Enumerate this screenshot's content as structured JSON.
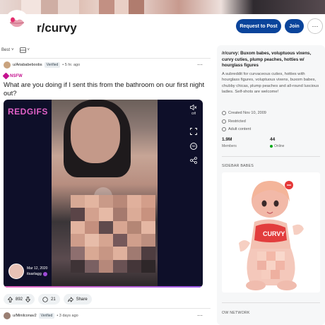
{
  "subreddit": {
    "name": "r/curvy",
    "request_button": "Request to Post",
    "join_button": "Join",
    "more_button": "⋯"
  },
  "sort": {
    "selected": "Best",
    "chevron": "˅",
    "view_chevron": "˅"
  },
  "post": {
    "author": "u/Ariababeboobs",
    "author_badge": "Verified",
    "time": "• 5 hr. ago",
    "menu": "⋯",
    "nsfw_label": "NSFW",
    "title": "What are you doing if I sent this from the bathroom on our first night out?",
    "media": {
      "brand": "REDGIFS",
      "mute_label": "Off",
      "sd_label": "SD",
      "creator_date": "Mar 12, 2020",
      "creator_handle": "itsarlagg",
      "progress_percent": 100
    },
    "upvotes": "892",
    "comments": "21",
    "share": "Share"
  },
  "next_post": {
    "author": "u/Minilconav2",
    "author_badge": "Verified",
    "time": "• 3 days ago",
    "menu": "⋯"
  },
  "sidebar": {
    "title": "/r/curvy: Buxom babes, voluptuous vixens, curvy cuties, plump peaches, hotties w/ hourglass figures",
    "description": "A subreddit for curvaceous cuties, hotties with hourglass figures, voluptuous vixens, buxom babes, chubby chicas, plump peaches and all-round luscious ladies. Self-shots are welcome!",
    "created": "Created Nov 10, 2009",
    "restricted": "Restricted",
    "adult": "Adult content",
    "members_value": "1.9M",
    "members_label": "Members",
    "online_value": "44",
    "online_label": "Online",
    "sidebar_babes": "SIDEBAR BABES",
    "ow_network": "OW NETWORK",
    "image_text": "CURVY"
  },
  "colors": {
    "primary_button": "#0a449b",
    "nsfw": "#c4128f",
    "redgifs": "#e060c6",
    "online": "#01a816"
  }
}
